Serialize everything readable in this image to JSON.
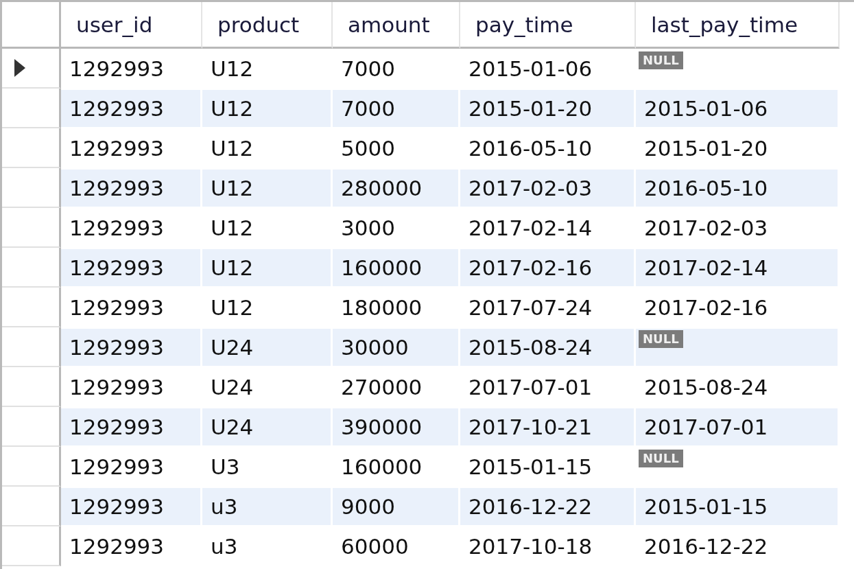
{
  "columns": [
    "user_id",
    "product",
    "amount",
    "pay_time",
    "last_pay_time"
  ],
  "rows": [
    {
      "current": true,
      "cells": [
        "1292993",
        "U12",
        "7000",
        "2015-01-06",
        {
          "kind": "null",
          "text": "NULL"
        }
      ]
    },
    {
      "current": false,
      "cells": [
        "1292993",
        "U12",
        "7000",
        "2015-01-20",
        "2015-01-06"
      ]
    },
    {
      "current": false,
      "cells": [
        "1292993",
        "U12",
        "5000",
        "2016-05-10",
        "2015-01-20"
      ]
    },
    {
      "current": false,
      "cells": [
        "1292993",
        "U12",
        "280000",
        "2017-02-03",
        "2016-05-10"
      ]
    },
    {
      "current": false,
      "cells": [
        "1292993",
        "U12",
        "3000",
        "2017-02-14",
        "2017-02-03"
      ]
    },
    {
      "current": false,
      "cells": [
        "1292993",
        "U12",
        "160000",
        "2017-02-16",
        "2017-02-14"
      ]
    },
    {
      "current": false,
      "cells": [
        "1292993",
        "U12",
        "180000",
        "2017-07-24",
        "2017-02-16"
      ]
    },
    {
      "current": false,
      "cells": [
        "1292993",
        "U24",
        "30000",
        "2015-08-24",
        {
          "kind": "null",
          "text": "NULL"
        }
      ]
    },
    {
      "current": false,
      "cells": [
        "1292993",
        "U24",
        "270000",
        "2017-07-01",
        "2015-08-24"
      ]
    },
    {
      "current": false,
      "cells": [
        "1292993",
        "U24",
        "390000",
        "2017-10-21",
        "2017-07-01"
      ]
    },
    {
      "current": false,
      "cells": [
        "1292993",
        "U3",
        "160000",
        "2015-01-15",
        {
          "kind": "null",
          "text": "NULL"
        }
      ]
    },
    {
      "current": false,
      "cells": [
        "1292993",
        "u3",
        "9000",
        "2016-12-22",
        "2015-01-15"
      ]
    },
    {
      "current": false,
      "cells": [
        "1292993",
        "u3",
        "60000",
        "2017-10-18",
        "2016-12-22"
      ]
    }
  ]
}
